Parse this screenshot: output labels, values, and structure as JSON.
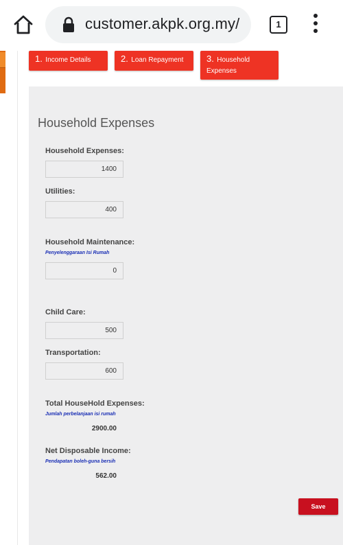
{
  "browser": {
    "url": "customer.akpk.org.my/",
    "tab_count": "1"
  },
  "steps": [
    {
      "num": "1.",
      "label": "Income Details"
    },
    {
      "num": "2.",
      "label": "Loan Repayment"
    },
    {
      "num": "3.",
      "label": "Household",
      "label2": "Expenses"
    }
  ],
  "form": {
    "heading": "Household Expenses",
    "household_expenses": {
      "label": "Household Expenses:",
      "value": "1400"
    },
    "utilities": {
      "label": "Utilities:",
      "value": "400"
    },
    "household_maintenance": {
      "label": "Household Maintenance:",
      "sublabel": "Penyelenggaraan Isi Rumah",
      "value": "0"
    },
    "child_care": {
      "label": "Child Care:",
      "value": "500"
    },
    "transportation": {
      "label": "Transportation:",
      "value": "600"
    },
    "total_expenses": {
      "label": "Total HouseHold Expenses:",
      "sublabel": "Jumlah perbelanjaan isi rumah",
      "value": "2900.00"
    },
    "net_income": {
      "label": "Net Disposable Income:",
      "sublabel": "Pendapatan boleh-guna bersih",
      "value": "562.00"
    },
    "save_label": "Save"
  },
  "colors": {
    "step_red": "#ee3324",
    "save_red": "#c8101f",
    "sublabel_blue": "#1a2fb5"
  },
  "icons": [
    "home-icon",
    "lock-icon",
    "tab-switcher-icon",
    "overflow-menu-icon"
  ]
}
